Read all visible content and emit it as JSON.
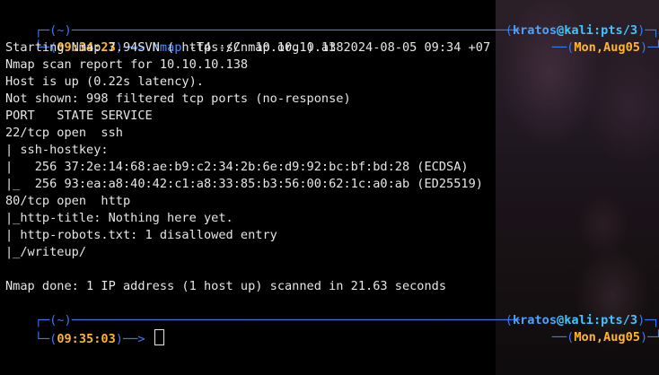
{
  "prompt1": {
    "bracket": "(~)",
    "time": "09:34:23",
    "arrow": "──>",
    "command": "nmap",
    "args": " -T4 -sC  10.10.10.138",
    "user": "kratos",
    "at": "@",
    "host": "kali:pts/3",
    "date": "Mon,Aug05"
  },
  "output": [
    "Starting Nmap 7.94SVN ( https://nmap.org ) at 2024-08-05 09:34 +07",
    "Nmap scan report for 10.10.10.138",
    "Host is up (0.22s latency).",
    "Not shown: 998 filtered tcp ports (no-response)",
    "PORT   STATE SERVICE",
    "22/tcp open  ssh",
    "| ssh-hostkey: ",
    "|   256 37:2e:14:68:ae:b9:c2:34:2b:6e:d9:92:bc:bf:bd:28 (ECDSA)",
    "|_  256 93:ea:a8:40:42:c1:a8:33:85:b3:56:00:62:1c:a0:ab (ED25519)",
    "80/tcp open  http",
    "|_http-title: Nothing here yet.",
    "| http-robots.txt: 1 disallowed entry ",
    "|_/writeup/",
    "",
    "Nmap done: 1 IP address (1 host up) scanned in 21.63 seconds"
  ],
  "prompt2": {
    "bracket": "(~)",
    "time": "09:35:03",
    "arrow": "──>",
    "user": "kratos",
    "at": "@",
    "host": "kali:pts/3",
    "date": "Mon,Aug05"
  },
  "colors": {
    "background": "#000000",
    "frame": "#3a7bf0",
    "time": "#ffb52e",
    "host": "#40c4ff",
    "text": "#e6e6e6"
  }
}
